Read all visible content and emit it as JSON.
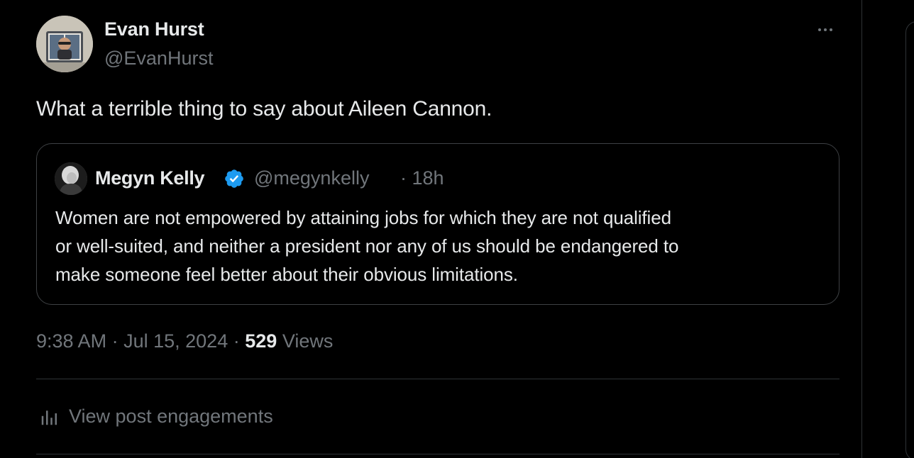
{
  "post": {
    "author": {
      "name": "Evan Hurst",
      "handle": "@EvanHurst"
    },
    "text": "What a terrible thing to say about Aileen Cannon.",
    "quoted": {
      "author_name": "Megyn Kelly",
      "handle": "@megynkelly",
      "time": "· 18h",
      "verified_icon": "verified-badge-icon",
      "lines": [
        "Women are not empowered by attaining jobs for which they are not qualified",
        "or well-suited, and neither a president nor any of us should be endangered to",
        "make someone feel better about their obvious limitations."
      ]
    },
    "meta": {
      "time": "9:38 AM",
      "sep1": "·",
      "date": "Jul 15, 2024",
      "sep2": "·",
      "views_count": "529",
      "views_label": "Views"
    },
    "engagements_label": "View post engagements"
  },
  "colors": {
    "background": "#000000",
    "text": "#e7e9ea",
    "muted": "#71767b",
    "border": "#2f3336",
    "verified": "#1d9bf0"
  }
}
